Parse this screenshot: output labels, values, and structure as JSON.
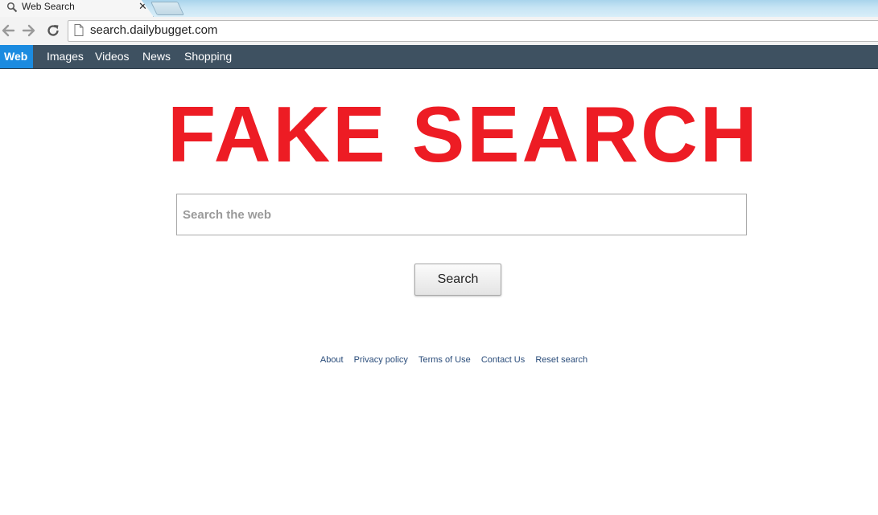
{
  "browser": {
    "tab_title": "Web Search",
    "tab_close": "✕",
    "url": "search.dailybugget.com"
  },
  "sitenav": {
    "items": [
      {
        "label": "Web",
        "active": true
      },
      {
        "label": "Images"
      },
      {
        "label": "Videos"
      },
      {
        "label": "News"
      },
      {
        "label": "Shopping"
      }
    ]
  },
  "main": {
    "headline": "FAKE SEARCH",
    "search_placeholder": "Search the web",
    "search_button": "Search"
  },
  "footer": {
    "links": [
      "About",
      "Privacy policy",
      "Terms of Use",
      "Contact Us",
      "Reset search"
    ]
  },
  "colors": {
    "nav_bar": "#3e5161",
    "nav_active": "#1b8be0",
    "headline": "#ed1c24",
    "footer_link": "#2a4c7a"
  }
}
